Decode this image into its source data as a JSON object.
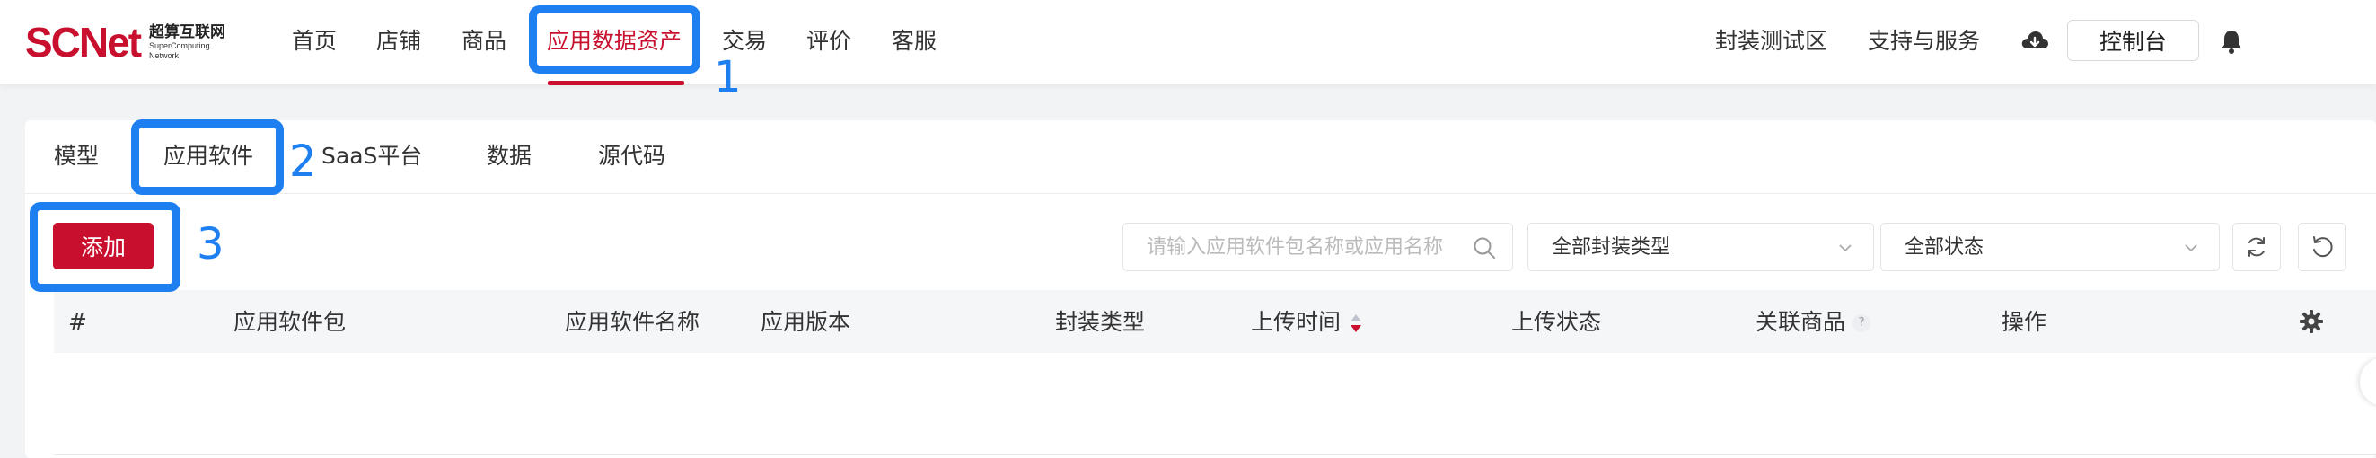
{
  "brand": {
    "mark": "SCNet",
    "name_cn": "超算互联网",
    "name_en_1": "SuperComputing",
    "name_en_2": "Network"
  },
  "nav": {
    "items": [
      "首页",
      "店铺",
      "商品",
      "应用数据资产",
      "交易",
      "评价",
      "客服"
    ],
    "active_index": 3
  },
  "header_right": {
    "links": [
      "封装测试区",
      "支持与服务"
    ],
    "cloud_icon": "cloud-download-icon",
    "console_label": "控制台",
    "bell_icon": "bell-icon"
  },
  "tabs": {
    "items": [
      "模型",
      "应用软件",
      "SaaS平台",
      "数据",
      "源代码"
    ],
    "active_index": 1
  },
  "toolbar": {
    "add_label": "添加",
    "search_placeholder": "请输入应用软件包名称或应用名称",
    "filter_type": "全部封装类型",
    "filter_status": "全部状态",
    "refresh_icon": "refresh-icon",
    "reset_icon": "reset-icon"
  },
  "table": {
    "columns": [
      "#",
      "应用软件包",
      "应用软件名称",
      "应用版本",
      "封装类型",
      "上传时间",
      "上传状态",
      "关联商品",
      "操作"
    ],
    "help_mark": "?",
    "settings_icon": "gear-icon",
    "rows": []
  },
  "annotations": {
    "labels": [
      "1",
      "2",
      "3"
    ],
    "color": "#1e7ff0"
  },
  "colors": {
    "brand_red": "#c8102e",
    "annotation_blue": "#1e7ff0"
  }
}
